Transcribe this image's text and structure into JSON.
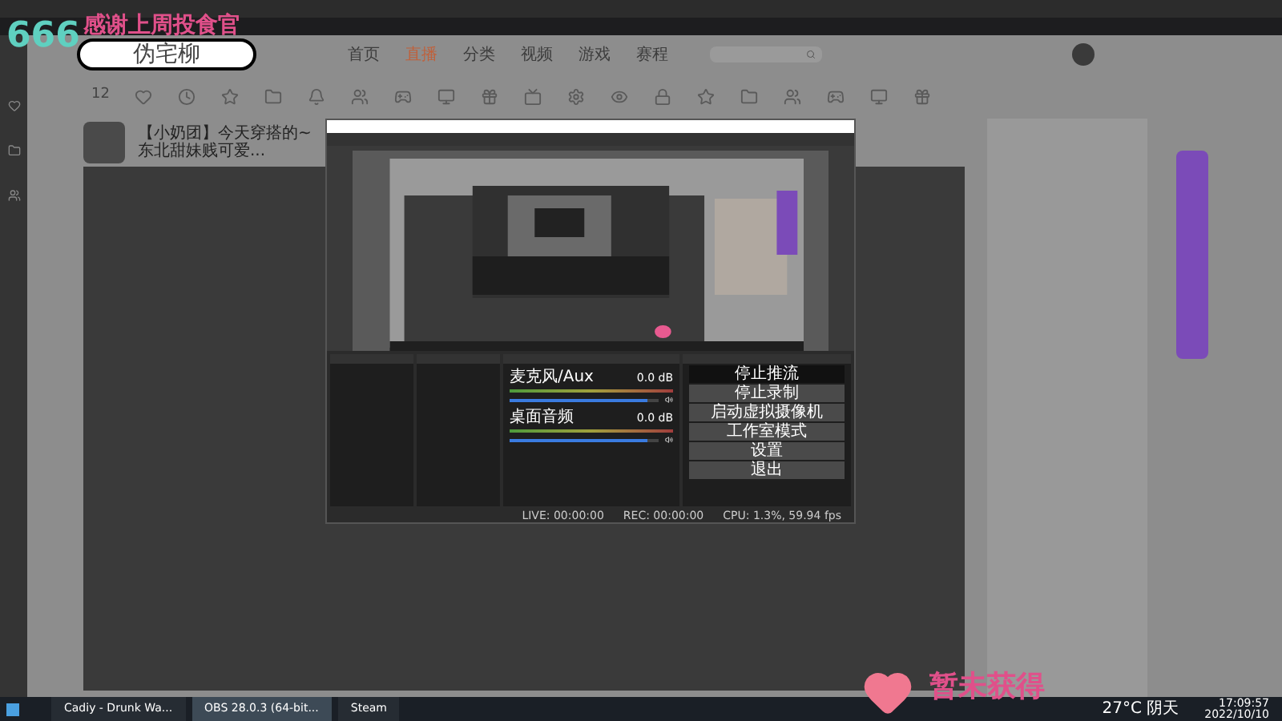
{
  "overlay": {
    "counter": "666",
    "thanks": "感谢上周投食官",
    "name": "伪宅柳",
    "badge": "暂未获得"
  },
  "site": {
    "nav": [
      {
        "label": "首页",
        "selected": false
      },
      {
        "label": "直播",
        "selected": true
      },
      {
        "label": "分类",
        "selected": false
      },
      {
        "label": "视频",
        "selected": false
      },
      {
        "label": "游戏",
        "selected": false
      },
      {
        "label": "赛程",
        "selected": false
      }
    ],
    "follow_count": "12",
    "room_title": "【小奶团】今天穿搭的~东北甜妹贱可爱..."
  },
  "obs": {
    "mixer": [
      {
        "name": "麦克风/Aux",
        "reading": "0.0 dB",
        "level": 0.92
      },
      {
        "name": "桌面音频",
        "reading": "0.0 dB",
        "level": 0.92
      }
    ],
    "controls": [
      {
        "label": "停止推流",
        "selected": true
      },
      {
        "label": "停止录制",
        "selected": false
      },
      {
        "label": "启动虚拟摄像机",
        "selected": false
      },
      {
        "label": "工作室模式",
        "selected": false
      },
      {
        "label": "设置",
        "selected": false
      },
      {
        "label": "退出",
        "selected": false
      }
    ],
    "status": [
      "LIVE: 00:00:00",
      "REC: 00:00:00",
      "CPU: 1.3%, 59.94 fps"
    ]
  },
  "taskbar": {
    "apps": [
      {
        "label": "Cadiy - Drunk Wa...",
        "selected": false
      },
      {
        "label": "OBS 28.0.3 (64-bit...",
        "selected": true
      },
      {
        "label": "Steam",
        "selected": false
      }
    ],
    "weather": "27°C 阴天",
    "time": "17:09:57",
    "date": "2022/10/10"
  }
}
